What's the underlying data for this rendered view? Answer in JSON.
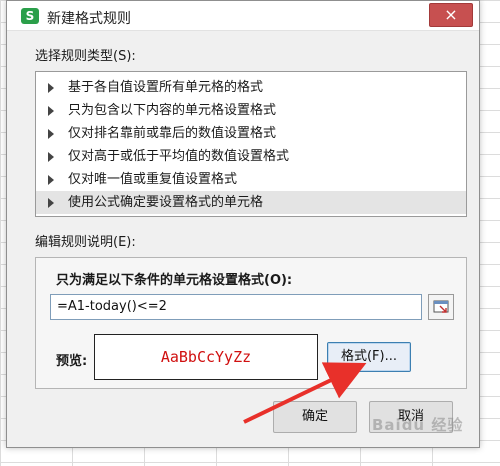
{
  "dialog": {
    "title": "新建格式规则",
    "app_icon_letter": "S",
    "close_glyph": "×"
  },
  "rule_type": {
    "label": "选择规则类型(S):",
    "items": [
      "基于各自值设置所有单元格的格式",
      "只为包含以下内容的单元格设置格式",
      "仅对排名靠前或靠后的数值设置格式",
      "仅对高于或低于平均值的数值设置格式",
      "仅对唯一值或重复值设置格式",
      "使用公式确定要设置格式的单元格"
    ],
    "selected_index": 5
  },
  "description": {
    "label": "编辑规则说明(E):",
    "condition_label": "只为满足以下条件的单元格设置格式(O):",
    "formula_value": "=A1-today()<=2",
    "preview_label": "预览:",
    "preview_text": "AaBbCcYyZz",
    "preview_color": "#d01010",
    "format_button": "格式(F)..."
  },
  "buttons": {
    "ok": "确定",
    "cancel": "取消"
  },
  "watermark": "Baidu 经验",
  "annotation_arrow_color": "#e8302a",
  "icons": [
    "app-icon",
    "close-icon",
    "expand-triangle-icon",
    "range-select-icon"
  ]
}
